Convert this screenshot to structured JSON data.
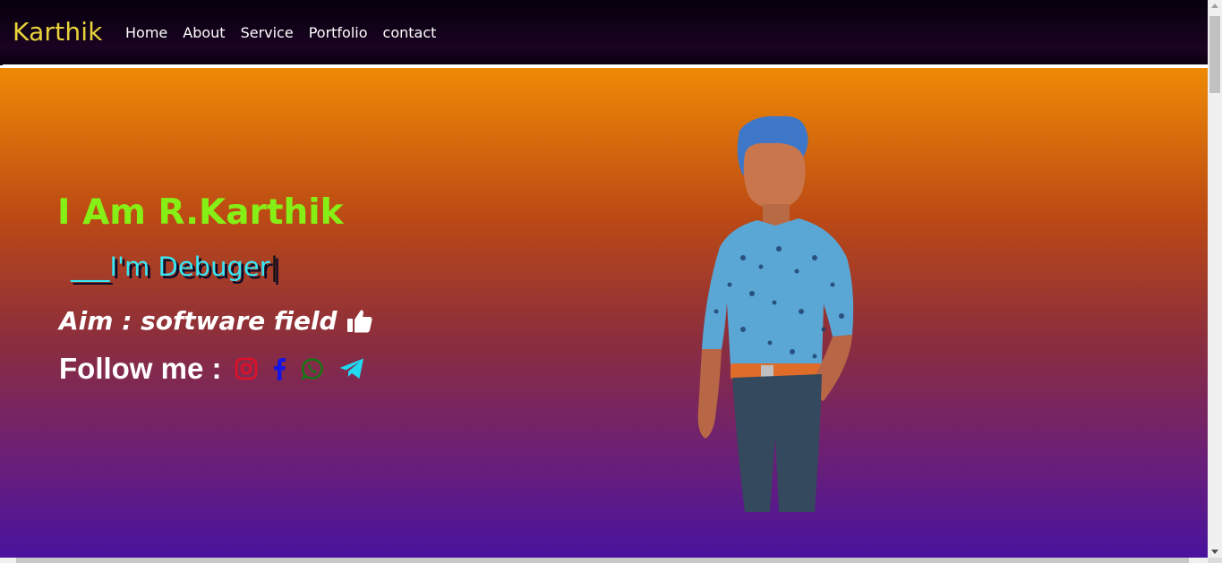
{
  "navbar": {
    "brand": "Karthik",
    "items": [
      {
        "label": "Home"
      },
      {
        "label": "About"
      },
      {
        "label": "Service"
      },
      {
        "label": "Portfolio"
      },
      {
        "label": "contact"
      }
    ]
  },
  "hero": {
    "title": "I Am R.Karthik",
    "typed_prefix": "___",
    "typed_text": "I'm Debuger",
    "typed_caret": "|",
    "aim": "Aim : software field",
    "follow_label": "Follow me :",
    "socials": [
      {
        "icon": "instagram-icon",
        "color": "#e0102a"
      },
      {
        "icon": "facebook-icon",
        "color": "#1414e6"
      },
      {
        "icon": "whatsapp-icon",
        "color": "#137a13"
      },
      {
        "icon": "telegram-icon",
        "color": "#20d8f0"
      }
    ]
  },
  "colors": {
    "brand": "#e8d43a",
    "title": "#86f016",
    "typed": "#3ae6f2",
    "gradient_top": "#ee8a05",
    "gradient_bottom": "#4a139e"
  }
}
